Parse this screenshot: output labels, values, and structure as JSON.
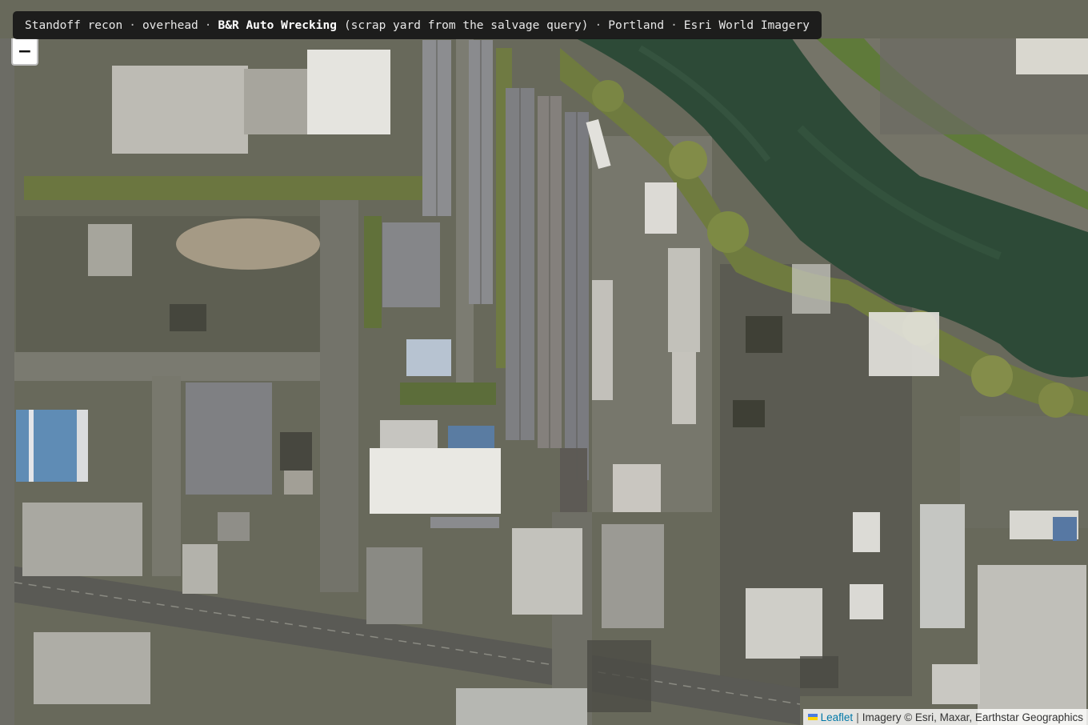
{
  "title_bar": {
    "prefix": "Standoff recon",
    "sep": "·",
    "view": "overhead",
    "place_name": "B&R Auto Wrecking",
    "place_note": "(scrap yard from the salvage query)",
    "city": "Portland",
    "imagery": "Esri World Imagery"
  },
  "zoom": {
    "out_label": "−"
  },
  "attribution": {
    "leaflet_label": "Leaflet",
    "pipe": "|",
    "imagery_credit": "Imagery © Esri, Maxar, Earthstar Geographics"
  },
  "colors": {
    "river": "#2e4a36",
    "vegetation": "#6d7a3e",
    "ground": "#666759",
    "flag_blue": "#4c7be1",
    "flag_yellow": "#ffd500"
  },
  "map": {
    "basemap": "satellite imagery",
    "features": [
      "salvage yard car rows",
      "river",
      "warehouse roofs",
      "roads",
      "parked trailers"
    ]
  }
}
